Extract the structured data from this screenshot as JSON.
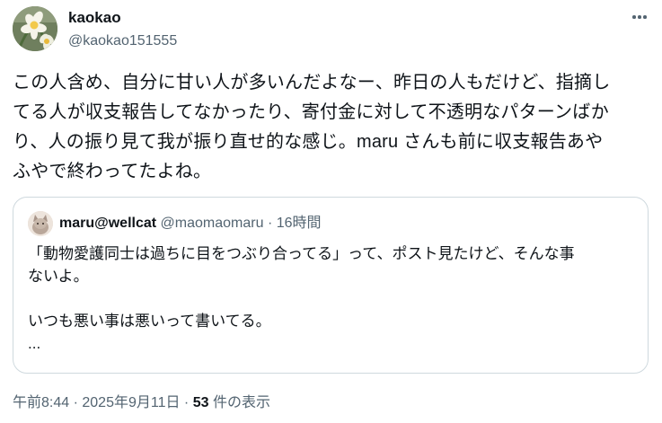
{
  "author": {
    "name": "kaokao",
    "handle": "@kaokao151555",
    "avatar_icon": "daffodil-avatar-icon"
  },
  "more_icon": "more-horizontal-icon",
  "tweet": {
    "lines": [
      "この人含め、自分に甘い人が多いんだよなー、昨日の人もだけど、指摘し",
      "てる人が収支報告してなかったり、寄付金に対して不透明なパターンばか",
      "り、人の振り見て我が振り直せ的な感じ。maru さんも前に収支報告あや",
      "ふやで終わってたよね。"
    ]
  },
  "quote": {
    "name": "maru@wellcat",
    "handle": "@maomaomaru",
    "separator": "·",
    "time": "16時間",
    "lines": [
      "「動物愛護同士は過ちに目をつぶり合ってる」って、ポスト見たけど、そんな事",
      "ないよ。",
      "",
      "いつも悪い事は悪いって書いてる。",
      "..."
    ]
  },
  "meta": {
    "time": "午前8:44",
    "sep1": " · ",
    "date": "2025年9月11日",
    "sep2": " · ",
    "views_count": "53",
    "views_label": " 件の表示"
  }
}
